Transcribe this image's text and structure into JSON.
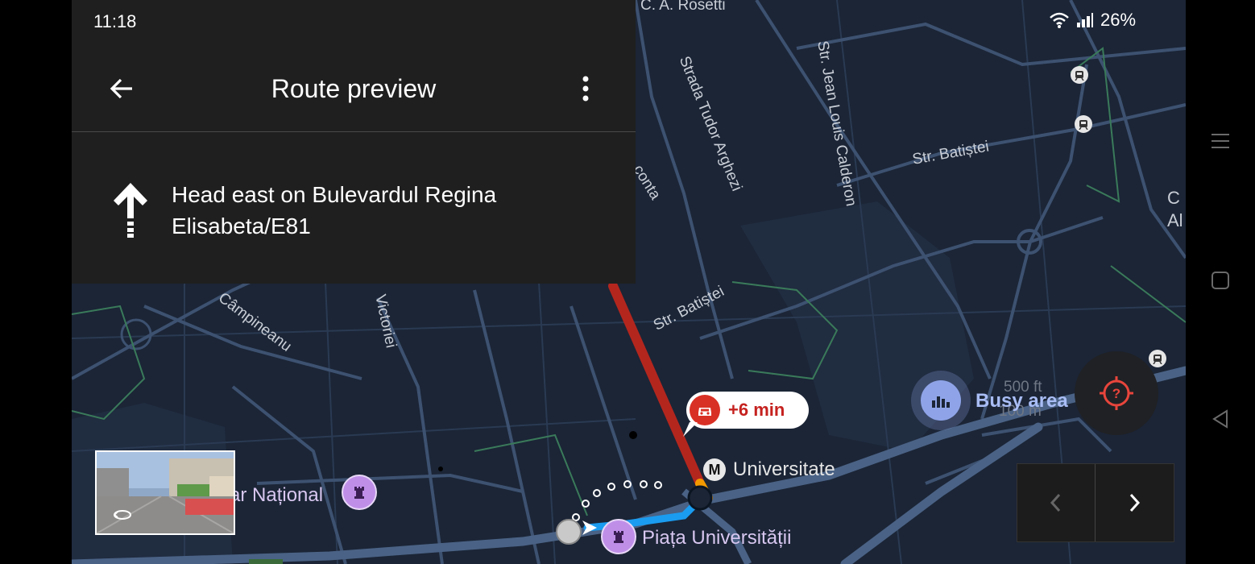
{
  "status_bar": {
    "time": "11:18",
    "battery": "26%"
  },
  "header": {
    "title": "Route preview"
  },
  "direction": {
    "instruction": "Head east on Bulevardul Regina Elisabeta/E81"
  },
  "map": {
    "streets": [
      "Strada Tudor Arghezi",
      "Str. Jean Louis Calderon",
      "Str. Batiștei",
      "Str. Batiștei",
      "Câmpineanu",
      "Victoriei",
      "C. A. Rosetti",
      "conta"
    ],
    "traffic_delay": "+6 min",
    "metro_badge": "M",
    "metro_station": "Universitate",
    "pois": [
      "ar Național",
      "Piața Universității"
    ],
    "busy_area": "Busy area",
    "scale": {
      "imperial": "500 ft",
      "metric": "100 m"
    },
    "edge_text": [
      "C",
      "Al"
    ]
  },
  "colors": {
    "map_bg": "#1b2536",
    "road": "#3d5170",
    "traffic_red": "#b3261e",
    "route_blue": "#1a9cf0",
    "panel_bg": "#1f1f1f"
  },
  "icons": [
    "back-arrow-icon",
    "more-vert-icon",
    "straight-arrow-icon",
    "traffic-car-icon",
    "landmark-icon",
    "busy-area-icon",
    "locate-icon",
    "chevron-left-icon",
    "chevron-right-icon",
    "tram-icon",
    "street-view-icon",
    "menu-icon",
    "square-icon",
    "triangle-back-icon",
    "wifi-icon",
    "signal-icon"
  ]
}
